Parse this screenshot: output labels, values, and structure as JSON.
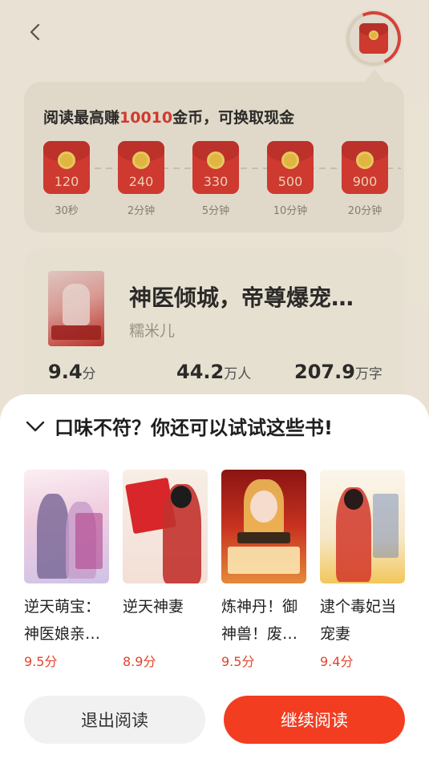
{
  "header": {
    "back_icon": "chevron-left-icon",
    "reward_icon": "red-envelope-icon"
  },
  "reward": {
    "title_prefix": "阅读最高赚",
    "title_highlight": "10010",
    "title_suffix": "金币，可换取现金",
    "highlight_color": "#e23a2f",
    "tiers": [
      {
        "amount": "120",
        "label": "30秒"
      },
      {
        "amount": "240",
        "label": "2分钟"
      },
      {
        "amount": "330",
        "label": "5分钟"
      },
      {
        "amount": "500",
        "label": "10分钟"
      },
      {
        "amount": "900",
        "label": "20分钟"
      }
    ]
  },
  "book": {
    "title": "神医倾城，帝尊爆宠…",
    "author": "糯米儿",
    "stats": [
      {
        "num": "9.4",
        "unit": "分"
      },
      {
        "num": "44.2",
        "unit": "万人"
      },
      {
        "num": "207.9",
        "unit": "万字"
      }
    ]
  },
  "sheet": {
    "collapse_icon": "chevron-down-icon",
    "title": "口味不符？你还可以试试这些书!",
    "recommendations": [
      {
        "title": "逆天萌宝：神医娘亲…",
        "rating": "9.5分"
      },
      {
        "title": "逆天神妻",
        "rating": "8.9分"
      },
      {
        "title": "炼神丹！御神兽！废…",
        "rating": "9.5分"
      },
      {
        "title": "逮个毒妃当宠妻",
        "rating": "9.4分"
      }
    ],
    "exit_label": "退出阅读",
    "continue_label": "继续阅读",
    "accent_color": "#f23d21"
  }
}
